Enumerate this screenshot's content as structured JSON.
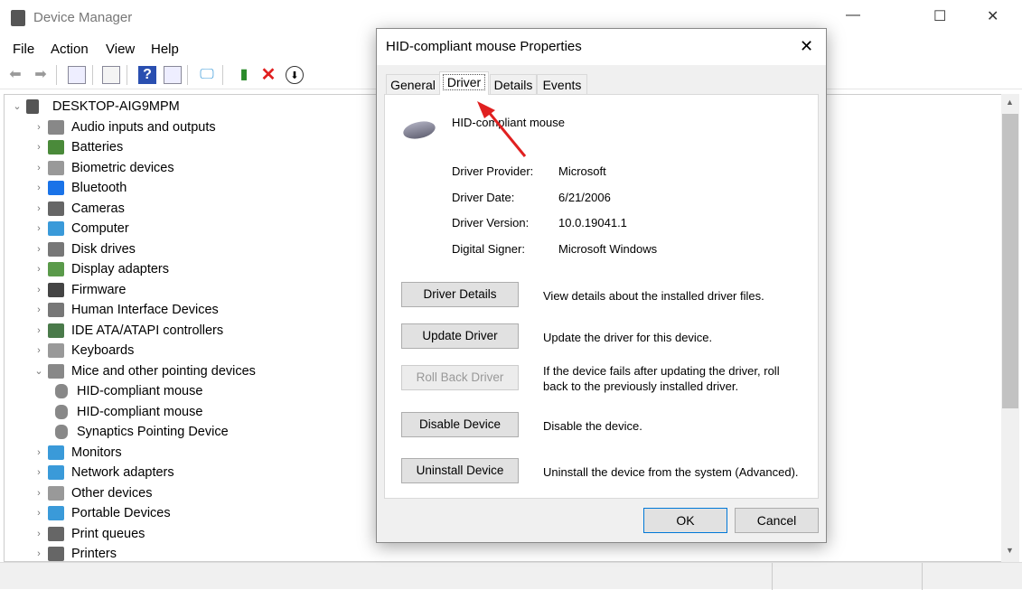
{
  "window": {
    "title": "Device Manager",
    "minimize": "—",
    "maximize": "☐",
    "close": "✕"
  },
  "menu": [
    "File",
    "Action",
    "View",
    "Help"
  ],
  "tree": {
    "root": "DESKTOP-AIG9MPM",
    "items": [
      {
        "label": "Audio inputs and outputs",
        "color": "#888"
      },
      {
        "label": "Batteries",
        "color": "#4a8a3a"
      },
      {
        "label": "Biometric devices",
        "color": "#999"
      },
      {
        "label": "Bluetooth",
        "color": "#1a73e8"
      },
      {
        "label": "Cameras",
        "color": "#666"
      },
      {
        "label": "Computer",
        "color": "#3a9ad9"
      },
      {
        "label": "Disk drives",
        "color": "#777"
      },
      {
        "label": "Display adapters",
        "color": "#5a9a4a"
      },
      {
        "label": "Firmware",
        "color": "#444"
      },
      {
        "label": "Human Interface Devices",
        "color": "#777"
      },
      {
        "label": "IDE ATA/ATAPI controllers",
        "color": "#4a7a4a"
      },
      {
        "label": "Keyboards",
        "color": "#999"
      },
      {
        "label": "Mice and other pointing devices",
        "color": "#888",
        "expanded": true
      },
      {
        "label": "HID-compliant mouse",
        "color": "#888",
        "child": true
      },
      {
        "label": "HID-compliant mouse",
        "color": "#888",
        "child": true
      },
      {
        "label": "Synaptics Pointing Device",
        "color": "#888",
        "child": true
      },
      {
        "label": "Monitors",
        "color": "#3a9ad9"
      },
      {
        "label": "Network adapters",
        "color": "#3a9ad9"
      },
      {
        "label": "Other devices",
        "color": "#999"
      },
      {
        "label": "Portable Devices",
        "color": "#3a9ad9"
      },
      {
        "label": "Print queues",
        "color": "#666"
      },
      {
        "label": "Printers",
        "color": "#666"
      }
    ]
  },
  "dialog": {
    "title": "HID-compliant mouse Properties",
    "tabs": [
      "General",
      "Driver",
      "Details",
      "Events"
    ],
    "device_name": "HID-compliant mouse",
    "fields": [
      {
        "label": "Driver Provider:",
        "value": "Microsoft"
      },
      {
        "label": "Driver Date:",
        "value": "6/21/2006"
      },
      {
        "label": "Driver Version:",
        "value": "10.0.19041.1"
      },
      {
        "label": "Digital Signer:",
        "value": "Microsoft Windows"
      }
    ],
    "actions": [
      {
        "label": "Driver Details",
        "desc": "View details about the installed driver files."
      },
      {
        "label": "Update Driver",
        "desc": "Update the driver for this device."
      },
      {
        "label": "Roll Back Driver",
        "desc": "If the device fails after updating the driver, roll back to the previously installed driver.",
        "disabled": true
      },
      {
        "label": "Disable Device",
        "desc": "Disable the device."
      },
      {
        "label": "Uninstall Device",
        "desc": "Uninstall the device from the system (Advanced)."
      }
    ],
    "ok": "OK",
    "cancel": "Cancel",
    "close": "✕"
  }
}
